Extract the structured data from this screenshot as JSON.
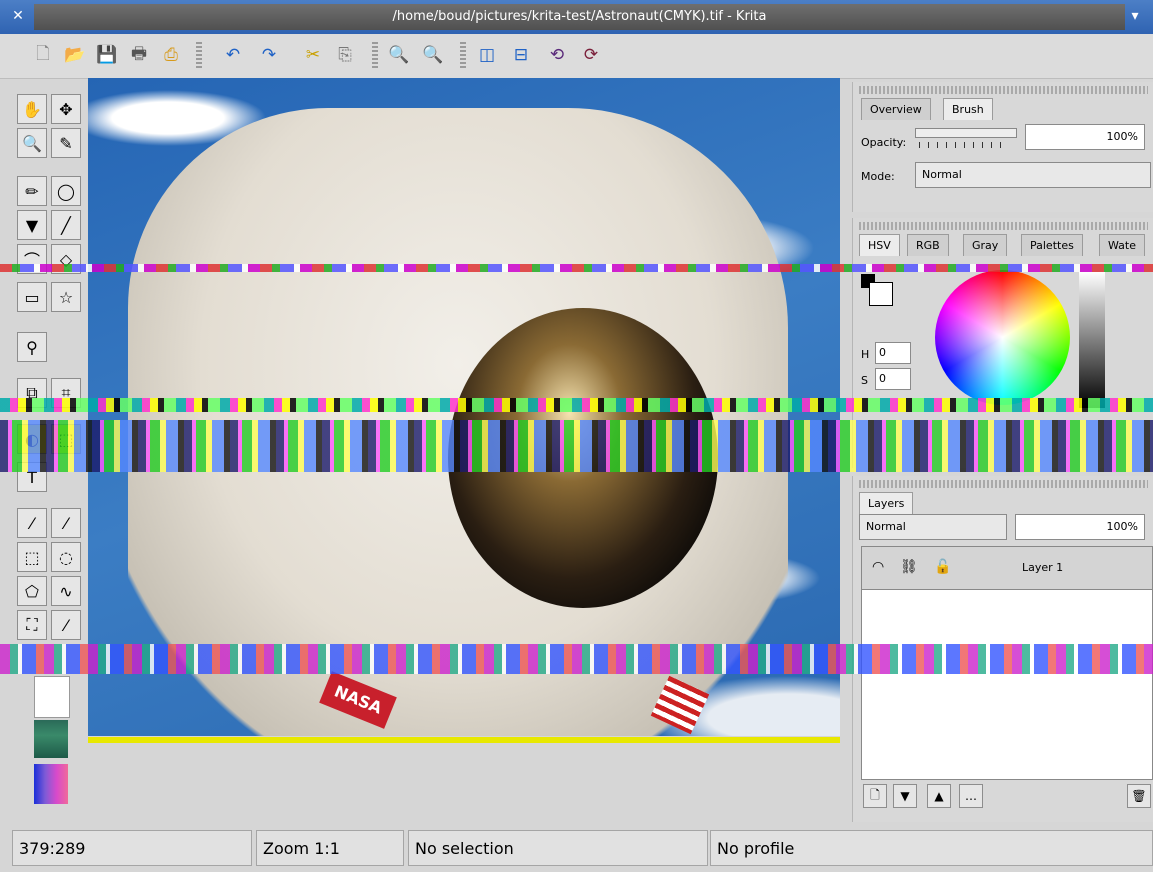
{
  "window": {
    "title": "/home/boud/pictures/krita-test/Astronaut(CMYK).tif - Krita",
    "close_icon": "close-icon",
    "menu_icon": "chevron-down-icon"
  },
  "toolbar": {
    "items": [
      "new-document-icon",
      "open-icon",
      "save-icon",
      "print-icon",
      "print-preview-icon",
      "undo-icon",
      "redo-icon",
      "cut-icon",
      "copy-icon",
      "zoom-in-icon",
      "zoom-out-icon",
      "split-vertical-icon",
      "split-horizontal-icon",
      "rotate-ccw-icon",
      "rotate-cw-icon"
    ]
  },
  "brush_panel": {
    "tabs": [
      "Overview",
      "Brush"
    ],
    "active_tab": "Brush",
    "opacity_label": "Opacity:",
    "opacity_value": "100%",
    "mode_label": "Mode:",
    "mode_value": "Normal"
  },
  "color_panel": {
    "tabs": [
      "HSV",
      "RGB",
      "Gray",
      "Palettes",
      "Wate"
    ],
    "active_tab": "HSV",
    "h_label": "H",
    "h_value": "0",
    "s_label": "S",
    "s_value": "0"
  },
  "layers_panel": {
    "tab": "Layers",
    "mode_value": "Normal",
    "opacity_value": "100%",
    "layers": [
      "Layer 1"
    ]
  },
  "status": {
    "coords": "379:289",
    "zoom": "Zoom 1:1",
    "selection": "No selection",
    "profile": "No profile"
  },
  "canvas": {
    "patch_text": "NASA"
  },
  "colors": {
    "title_bg": "#2f63b2",
    "window_bg": "#d6d6d6",
    "sky": "#2f6fb6",
    "highlight_yellow": "#e8e800"
  }
}
